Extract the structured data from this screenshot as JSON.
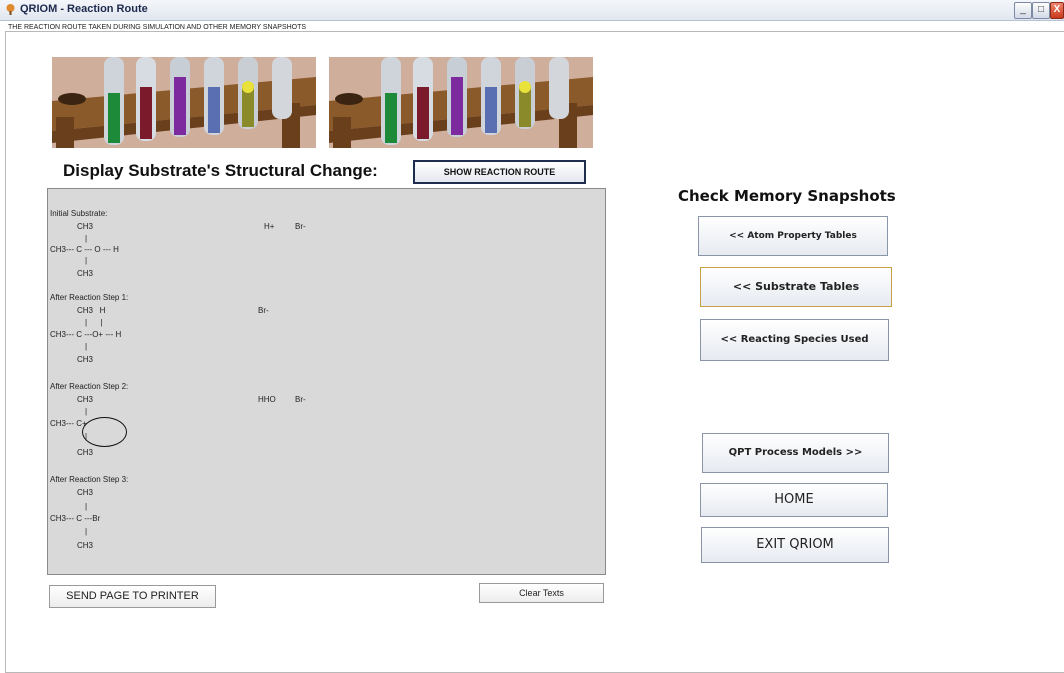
{
  "window": {
    "title": "QRIOM - Reaction Route"
  },
  "panel": {
    "caption": "THE REACTION ROUTE TAKEN DURING SIMULATION AND OTHER MEMORY SNAPSHOTS"
  },
  "left": {
    "heading": "Display Substrate's Structural Change:",
    "show_route_label": "SHOW REACTION ROUTE",
    "send_print_label": "SEND PAGE TO PRINTER",
    "clear_label": "Clear Texts",
    "text": {
      "l1": "Initial Substrate:",
      "l2": "CH3",
      "l2b": "H+",
      "l2c": "Br-",
      "l3": "|",
      "l4": "CH3--- C --- O --- H",
      "l5": "|",
      "l6": "CH3",
      "l7": "After Reaction Step 1:",
      "l8": "CH3   H",
      "l8b": "Br-",
      "l9": "|      |",
      "l10": "CH3--- C ---O+ --- H",
      "l11": "|",
      "l12": "CH3",
      "l13": "After Reaction Step 2:",
      "l14": "CH3",
      "l14b": "HHO",
      "l14c": "Br-",
      "l15": "|",
      "l16": "CH3--- C+",
      "l17": "|",
      "l18": "CH3",
      "l19": "After Reaction Step 3:",
      "l20": "CH3",
      "l21": "|",
      "l22": "CH3--- C ---Br",
      "l23": "|",
      "l24": "CH3"
    }
  },
  "right": {
    "heading": "Check Memory Snapshots",
    "atom_label": "<<  Atom Property Tables",
    "substrate_label": "<<  Substrate Tables",
    "species_label": "<<  Reacting Species Used",
    "qpt_label": "QPT Process Models >>",
    "home_label": "HOME",
    "exit_label": "EXIT QRIOM"
  },
  "colors": {
    "accent": "#1e2d4d",
    "textarea_bg": "#d9d9d9",
    "highlight_border": "#c8a24a"
  }
}
